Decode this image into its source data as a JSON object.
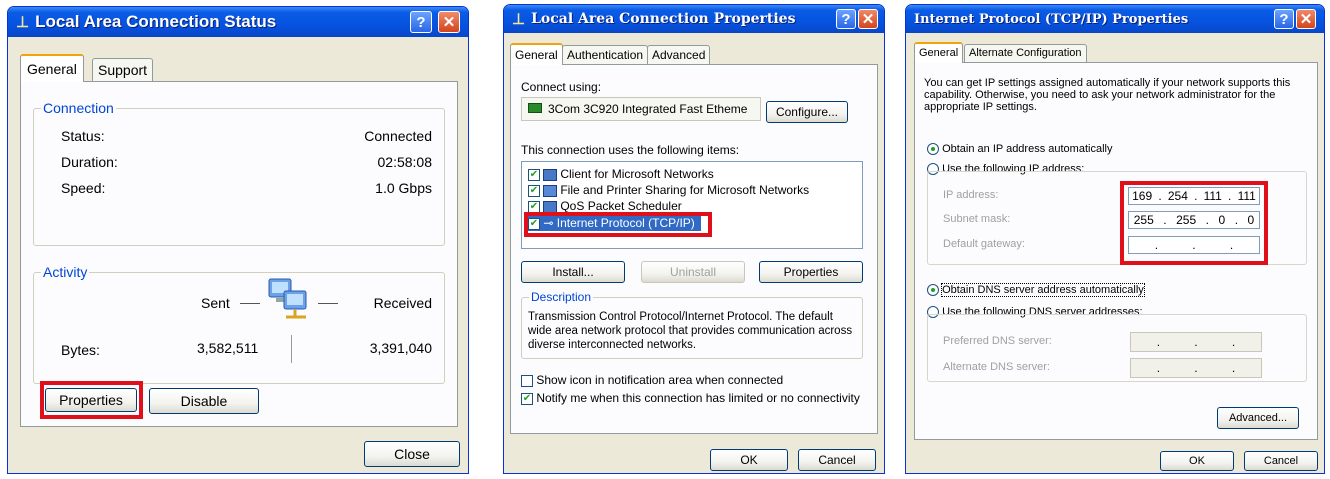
{
  "dialog1": {
    "title": "Local Area Connection Status",
    "tabs": [
      "General",
      "Support"
    ],
    "connection_group": "Connection",
    "rows": [
      {
        "label": "Status:",
        "value": "Connected"
      },
      {
        "label": "Duration:",
        "value": "02:58:08"
      },
      {
        "label": "Speed:",
        "value": "1.0 Gbps"
      }
    ],
    "activity_group": "Activity",
    "sent_label": "Sent",
    "received_label": "Received",
    "bytes_label": "Bytes:",
    "bytes_sent": "3,582,511",
    "bytes_received": "3,391,040",
    "properties_button": "Properties",
    "disable_button": "Disable",
    "close_button": "Close"
  },
  "dialog2": {
    "title": "Local Area Connection Properties",
    "tabs": [
      "General",
      "Authentication",
      "Advanced"
    ],
    "connect_using_label": "Connect using:",
    "adapter_name": "3Com 3C920 Integrated Fast Etheme",
    "configure_button": "Configure...",
    "items_label": "This connection uses the following items:",
    "items": [
      "Client for Microsoft Networks",
      "File and Printer Sharing for Microsoft Networks",
      "QoS Packet Scheduler",
      "Internet Protocol (TCP/IP)"
    ],
    "install_button": "Install...",
    "uninstall_button": "Uninstall",
    "properties_button": "Properties",
    "description_group": "Description",
    "description_text": "Transmission Control Protocol/Internet Protocol. The default wide area network protocol that provides communication across diverse interconnected networks.",
    "show_icon_label": "Show icon in notification area when connected",
    "notify_label": "Notify me when this connection has limited or no connectivity",
    "ok_button": "OK",
    "cancel_button": "Cancel"
  },
  "dialog3": {
    "title": "Internet Protocol (TCP/IP) Properties",
    "tabs": [
      "General",
      "Alternate Configuration"
    ],
    "intro_text": "You can get IP settings assigned automatically if your network supports this capability. Otherwise, you need to ask your network administrator for the appropriate IP settings.",
    "obtain_ip_label": "Obtain an IP address automatically",
    "use_ip_label": "Use the following IP address:",
    "ip_address_label": "IP address:",
    "subnet_mask_label": "Subnet mask:",
    "default_gateway_label": "Default gateway:",
    "ip_address": [
      "169",
      "254",
      "111",
      "111"
    ],
    "subnet_mask": [
      "255",
      "255",
      "0",
      "0"
    ],
    "obtain_dns_label": "Obtain DNS server address automatically",
    "use_dns_label": "Use the following DNS server addresses:",
    "preferred_dns_label": "Preferred DNS server:",
    "alternate_dns_label": "Alternate DNS server:",
    "advanced_button": "Advanced...",
    "ok_button": "OK",
    "cancel_button": "Cancel"
  },
  "colors": {
    "title_bar": "#0553e0",
    "dialog_bg": "#ece9d8",
    "highlight_box": "#e0101a",
    "group_label": "#0046d5"
  }
}
